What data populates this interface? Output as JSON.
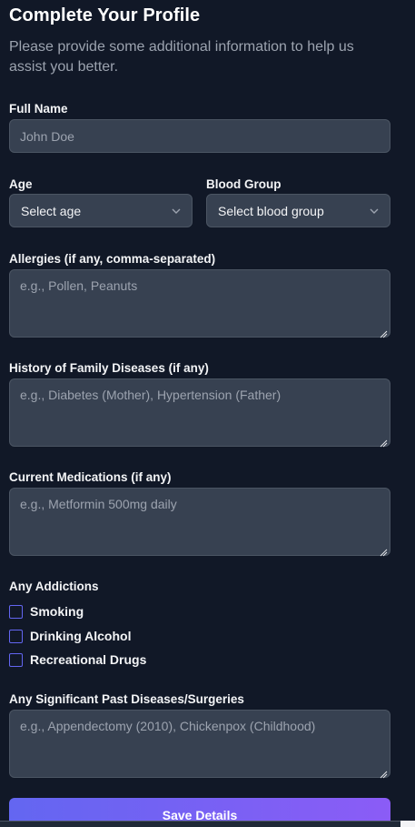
{
  "form": {
    "title": "Complete Your Profile",
    "subtitle": "Please provide some additional information to help us assist you better.",
    "full_name": {
      "label": "Full Name",
      "placeholder": "John Doe"
    },
    "age": {
      "label": "Age",
      "value": "Select age"
    },
    "blood_group": {
      "label": "Blood Group",
      "value": "Select blood group"
    },
    "allergies": {
      "label": "Allergies (if any, comma-separated)",
      "placeholder": "e.g., Pollen, Peanuts"
    },
    "family_history": {
      "label": "History of Family Diseases (if any)",
      "placeholder": "e.g., Diabetes (Mother), Hypertension (Father)"
    },
    "medications": {
      "label": "Current Medications (if any)",
      "placeholder": "e.g., Metformin 500mg daily"
    },
    "addictions": {
      "label": "Any Addictions",
      "options": [
        {
          "label": "Smoking",
          "checked": false
        },
        {
          "label": "Drinking Alcohol",
          "checked": false
        },
        {
          "label": "Recreational Drugs",
          "checked": false
        }
      ]
    },
    "past_diseases": {
      "label": "Any Significant Past Diseases/Surgeries",
      "placeholder": "e.g., Appendectomy (2010), Chickenpox (Childhood)"
    },
    "save_label": "Save Details"
  },
  "colors": {
    "accent_start": "#6366f1",
    "accent_end": "#8b5cf6",
    "background": "#111827",
    "field": "#374151"
  }
}
